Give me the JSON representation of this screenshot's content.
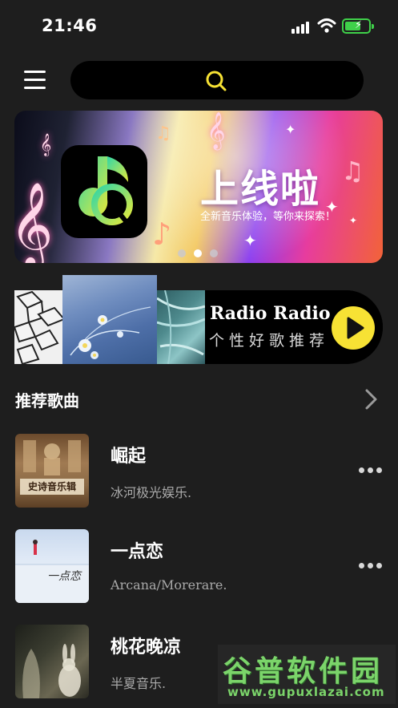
{
  "status_bar": {
    "time": "21:46"
  },
  "search": {
    "icon": "search-icon",
    "accent": "#f7e234"
  },
  "banner": {
    "headline": "上线啦",
    "subtitle": "全新音乐体验，等你来探索！",
    "dots": 3,
    "active_dot": 2
  },
  "radio": {
    "title": "Radio Radio",
    "subtitle": "个性好歌推荐",
    "play_icon": "play-icon"
  },
  "section": {
    "title": "推荐歌曲",
    "more_icon": "chevron-right-icon"
  },
  "songs": [
    {
      "name": "崛起",
      "artist": "冰河极光娱乐.",
      "cover_text": "史诗音乐辑"
    },
    {
      "name": "一点恋",
      "artist": "Arcana/Morerare.",
      "cover_text": "一点恋"
    },
    {
      "name": "桃花晚凉",
      "artist": "半夏音乐."
    }
  ],
  "watermark": {
    "title": "谷普软件园",
    "url": "www.gupuxlazai.com"
  },
  "colors": {
    "background": "#1e1e1e",
    "accent": "#f7e234",
    "battery": "#3fd14a"
  }
}
